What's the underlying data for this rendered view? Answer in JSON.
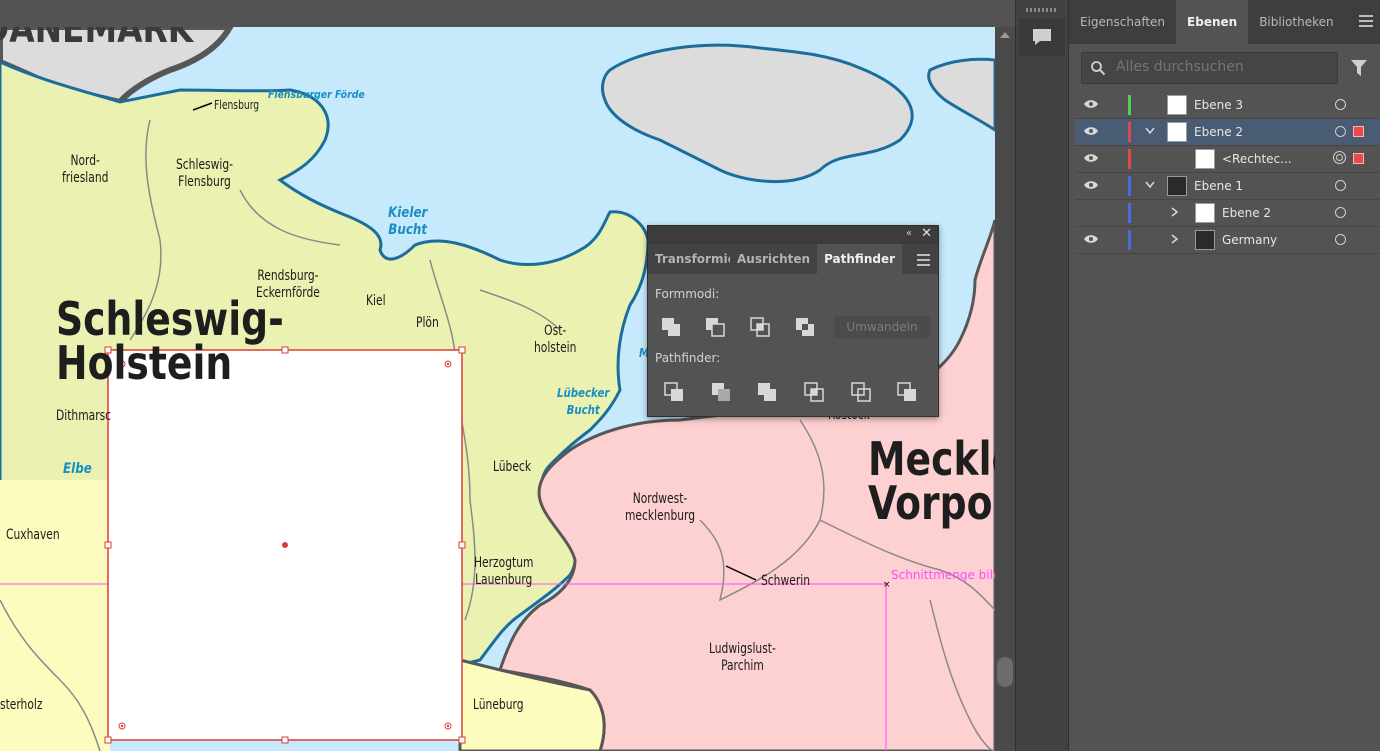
{
  "colors": {
    "water": "#c6eafc",
    "land_yellow": "#ebf2b1",
    "land_pink": "#fdd0d1",
    "land_grey": "#dcdcdc",
    "land_lightyellow": "#fdfcbf",
    "coast": "#1b6e9b",
    "selection": "#e03a3a",
    "guide": "#ff49ff"
  },
  "map": {
    "labels": {
      "daenemark": "DÄNEMARK",
      "flensburg": "Flensburg",
      "flensburger_foerde": "Flensburger Förde",
      "nordfriesland": "Nord-\nfriesland",
      "schleswig_flensburg": "Schleswig-\nFlensburg",
      "kieler_bucht": "Kieler\nBucht",
      "rendsburg": "Rendsburg-\nEckernförde",
      "kiel": "Kiel",
      "ploen": "Plön",
      "ostholstein": "Ost-\nholstein",
      "schleswig_holstein": "Schleswig-\nHolstein",
      "dithmarschen": "Dithmarsc",
      "elbe": "Elbe",
      "luebecker_bucht": "Lübecker\nBucht",
      "luebeck": "Lübeck",
      "cuxhaven": "Cuxhaven",
      "herzogtum": "Herzogtum\nLauenburg",
      "nordwest": "Nordwest-\nmecklenburg",
      "schwerin": "Schwerin",
      "ludwigslust": "Ludwigslust-\nParchim",
      "rostock": "Rostock",
      "mecklenburg": "Meckle\nVorpo",
      "osterholz": "sterholz",
      "lueneburg": "Lüneburg",
      "m_fragment": "M"
    },
    "hint": "Schnittmenge bild"
  },
  "pathfinder": {
    "tabs": [
      "Transformie",
      "Ausrichten",
      "Pathfinder"
    ],
    "active_tab": "Pathfinder",
    "formmodi_label": "Formmodi:",
    "pathfinder_label": "Pathfinder:",
    "convert_label": "Umwandeln"
  },
  "panel": {
    "tabs": [
      "Eigenschaften",
      "Ebenen",
      "Bibliotheken"
    ],
    "active_tab": "Ebenen",
    "search_placeholder": "Alles durchsuchen",
    "rows": [
      {
        "name": "Ebene 3",
        "color": "#4fd24f",
        "visible": true,
        "expand": false,
        "selected": false
      },
      {
        "name": "Ebene 2",
        "color": "#e14848",
        "visible": true,
        "expand": true,
        "selected": true
      },
      {
        "name": "<Rechtec...",
        "color": "#e14848",
        "visible": true,
        "expand": false,
        "selected": false
      },
      {
        "name": "Ebene 1",
        "color": "#4a6be0",
        "visible": true,
        "expand": true,
        "selected": false
      },
      {
        "name": "Ebene 2",
        "color": "#4a6be0",
        "visible": false,
        "expand": false,
        "selected": false
      },
      {
        "name": "Germany",
        "color": "#4a6be0",
        "visible": true,
        "expand": false,
        "selected": false
      }
    ]
  }
}
